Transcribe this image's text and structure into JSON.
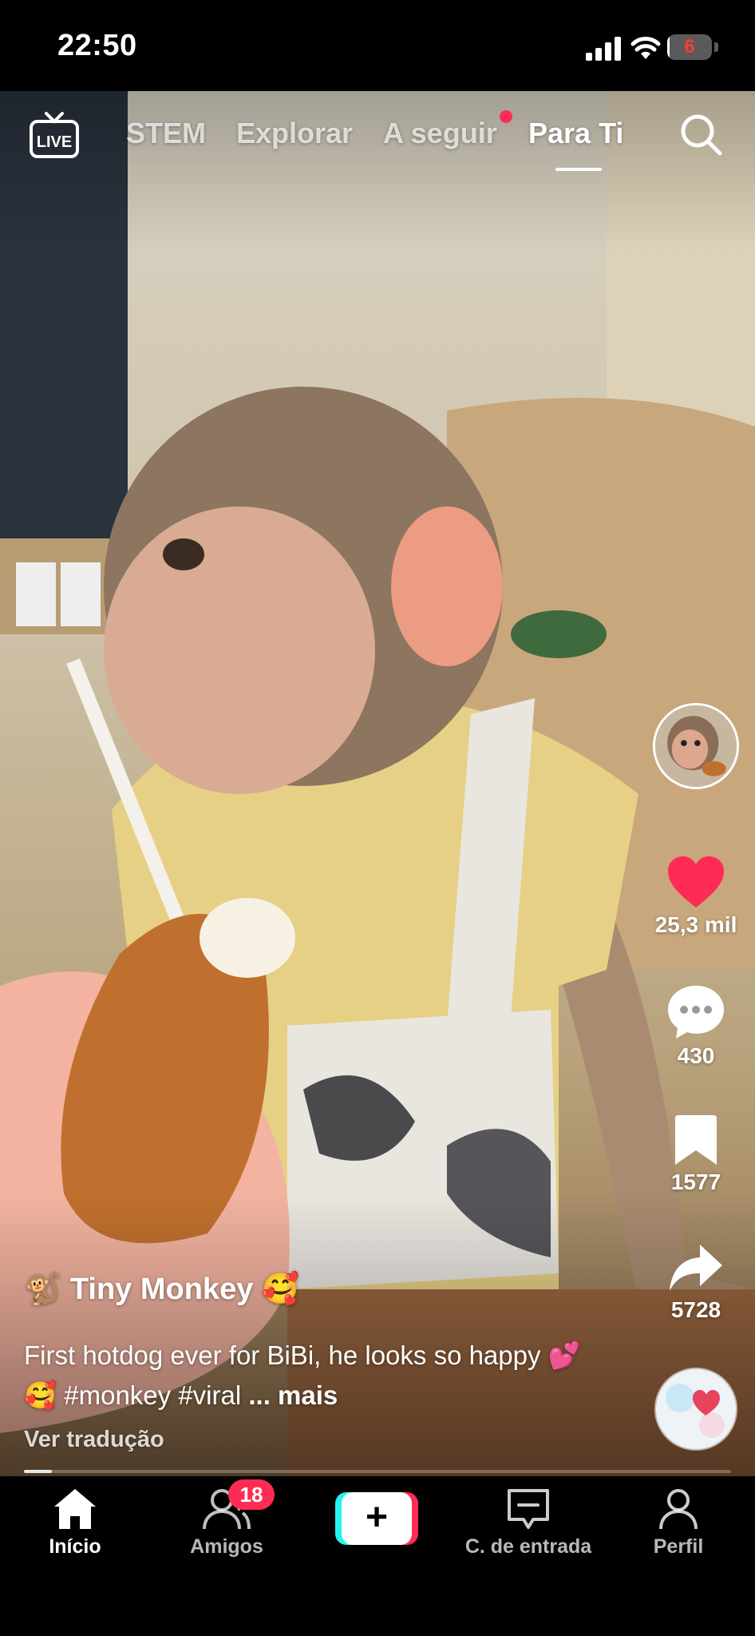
{
  "status_bar": {
    "time": "22:50",
    "battery_level": "6",
    "battery_fraction": 0.06,
    "icons": [
      "signal-icon",
      "wifi-icon",
      "battery-icon"
    ]
  },
  "top_nav": {
    "live_label": "LIVE",
    "tabs": [
      {
        "label": "STEM",
        "active": false
      },
      {
        "label": "Explorar",
        "active": false
      },
      {
        "label": "A seguir",
        "active": false,
        "has_dot": true
      },
      {
        "label": "Para Ti",
        "active": true
      }
    ],
    "icons": [
      "live-icon",
      "search-icon"
    ]
  },
  "video": {
    "author": "🐒 Tiny Monkey 🥰",
    "caption": "First hotdog ever for BiBi, he looks so happy 💕 🥰 #monkey #viral",
    "more_label": "... mais",
    "translate_label": "Ver tradução",
    "progress": 0.04
  },
  "actions": {
    "likes": "25,3 mil",
    "comments": "430",
    "saves": "1577",
    "shares": "5728",
    "like_color": "#fe2c55"
  },
  "bottom_nav": {
    "items": [
      {
        "label": "Início",
        "icon": "home-icon",
        "active": true
      },
      {
        "label": "Amigos",
        "icon": "friends-icon",
        "badge": "18"
      },
      {
        "label": "",
        "icon": "create-icon"
      },
      {
        "label": "C. de entrada",
        "icon": "inbox-icon"
      },
      {
        "label": "Perfil",
        "icon": "profile-icon"
      }
    ]
  },
  "colors": {
    "accent": "#fe2c55",
    "cyan": "#25f4ee",
    "background": "#000000"
  }
}
